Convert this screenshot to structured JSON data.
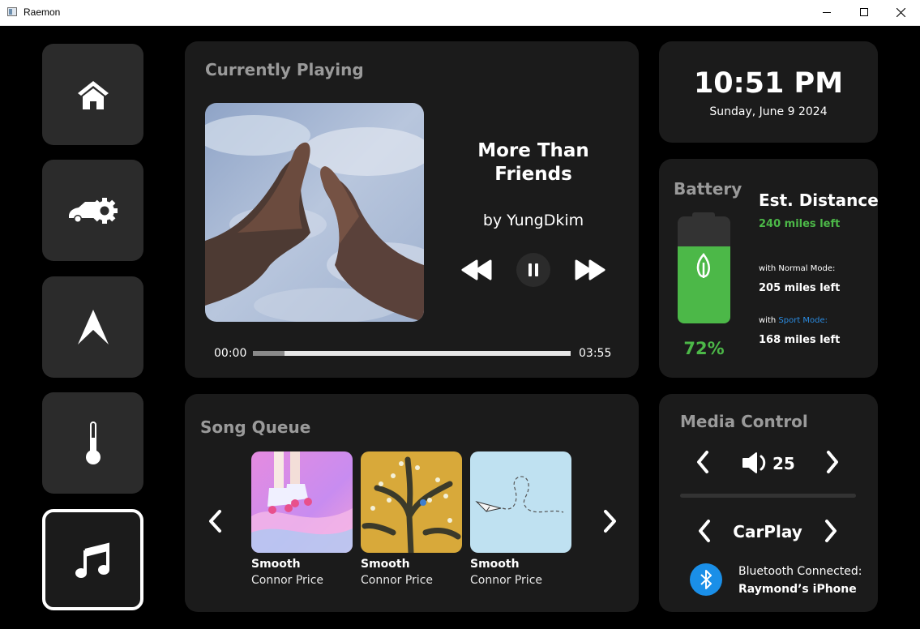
{
  "window": {
    "title": "Raemon"
  },
  "nav": {
    "items": [
      "home-icon",
      "car-settings-icon",
      "navigation-icon",
      "thermometer-icon",
      "music-note-icon"
    ],
    "active": "music"
  },
  "now_playing": {
    "heading": "Currently Playing",
    "title_line1": "More Than",
    "title_line2": "Friends",
    "artist": "by YungDkim",
    "time_elapsed": "00:00",
    "time_total": "03:55",
    "progress": 0.1
  },
  "clock": {
    "time": "10:51 PM",
    "date": "Sunday, June 9 2024"
  },
  "battery": {
    "heading": "Battery",
    "percent_label": "72%",
    "level": 0.72,
    "est_heading": "Est. Distance",
    "miles_left": "240 miles left",
    "normal_prefix": "with Normal Mode:",
    "normal_miles": "205 miles left",
    "sport_prefix": "with ",
    "sport_label": "Sport Mode:",
    "sport_miles": "168 miles left",
    "colors": {
      "green": "#4cb848",
      "sport": "#2b8be0"
    }
  },
  "queue": {
    "heading": "Song Queue",
    "songs": [
      {
        "title": "Smooth",
        "artist": "Connor Price"
      },
      {
        "title": "Smooth",
        "artist": "Connor Price"
      },
      {
        "title": "Smooth",
        "artist": "Connor Price"
      }
    ]
  },
  "media_control": {
    "heading": "Media Control",
    "volume": "25",
    "source": "CarPlay",
    "bt_label": "Bluetooth Connected:",
    "bt_device": "Raymond’s iPhone",
    "colors": {
      "bluetooth": "#1a8fe8"
    }
  }
}
